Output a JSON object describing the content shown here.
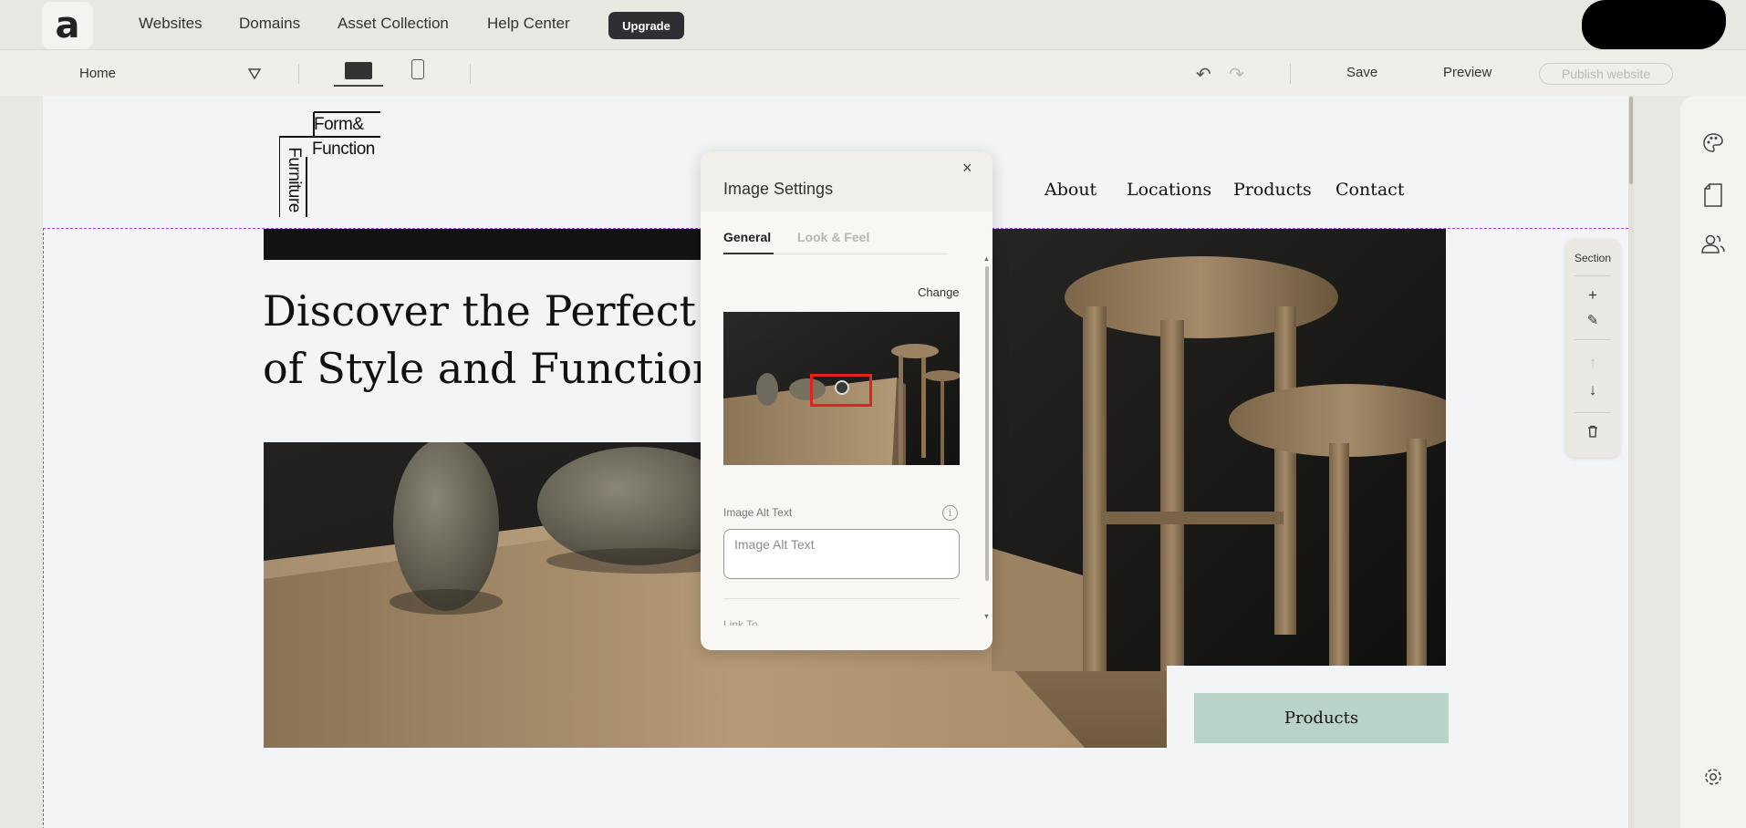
{
  "topnav": {
    "logo_glyph": "a",
    "links": [
      "Websites",
      "Domains",
      "Asset Collection",
      "Help Center"
    ],
    "upgrade_label": "Upgrade"
  },
  "toolbar": {
    "page_name": "Home",
    "save_label": "Save",
    "preview_label": "Preview",
    "publish_label": "Publish website"
  },
  "site": {
    "logo_top": "Form&",
    "logo_middle": "Function",
    "logo_vertical": "Furniture",
    "nav": [
      "About",
      "Locations",
      "Products",
      "Contact"
    ],
    "hero_line1": "Discover the Perfect B",
    "hero_line2": "of Style and Functiona",
    "products_button": "Products"
  },
  "section_tools": {
    "label": "Section"
  },
  "modal": {
    "title": "Image Settings",
    "tabs": [
      "General",
      "Look & Feel"
    ],
    "change_label": "Change",
    "alt_label": "Image Alt Text",
    "alt_placeholder": "Image Alt Text",
    "link_label": "Link To"
  },
  "colors": {
    "accent_button": "#b9d3c9",
    "section_outline": "#9b40e6",
    "focal_highlight": "#e0231c"
  }
}
